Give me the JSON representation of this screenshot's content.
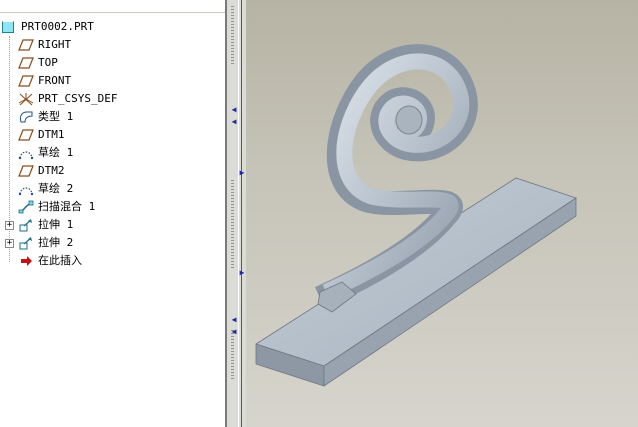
{
  "model_tree": {
    "root_label": "PRT0002.PRT",
    "items": [
      {
        "label": "RIGHT",
        "icon": "datum-plane-icon",
        "expandable": false
      },
      {
        "label": "TOP",
        "icon": "datum-plane-icon",
        "expandable": false
      },
      {
        "label": "FRONT",
        "icon": "datum-plane-icon",
        "expandable": false
      },
      {
        "label": "PRT_CSYS_DEF",
        "icon": "coordinate-system-icon",
        "expandable": false
      },
      {
        "label": "类型 1",
        "icon": "datum-curve-icon",
        "expandable": false
      },
      {
        "label": "DTM1",
        "icon": "datum-plane-icon",
        "expandable": false
      },
      {
        "label": "草绘 1",
        "icon": "sketch-icon",
        "expandable": false
      },
      {
        "label": "DTM2",
        "icon": "datum-plane-icon",
        "expandable": false
      },
      {
        "label": "草绘 2",
        "icon": "sketch-icon",
        "expandable": false
      },
      {
        "label": "扫描混合 1",
        "icon": "swept-blend-icon",
        "expandable": false
      },
      {
        "label": "拉伸 1",
        "icon": "extrude-icon",
        "expandable": true
      },
      {
        "label": "拉伸 2",
        "icon": "extrude-icon",
        "expandable": true
      },
      {
        "label": "在此插入",
        "icon": "insert-here-arrow-icon",
        "expandable": false
      }
    ]
  },
  "colors": {
    "viewport_background_top": "#b6b3a4",
    "viewport_background_bottom": "#d6d4cc",
    "model_surface": "#a9b4c0",
    "tree_background": "#ffffff",
    "splitter_arrows": "#1c2aa8",
    "insert_arrow": "#cc1010"
  }
}
